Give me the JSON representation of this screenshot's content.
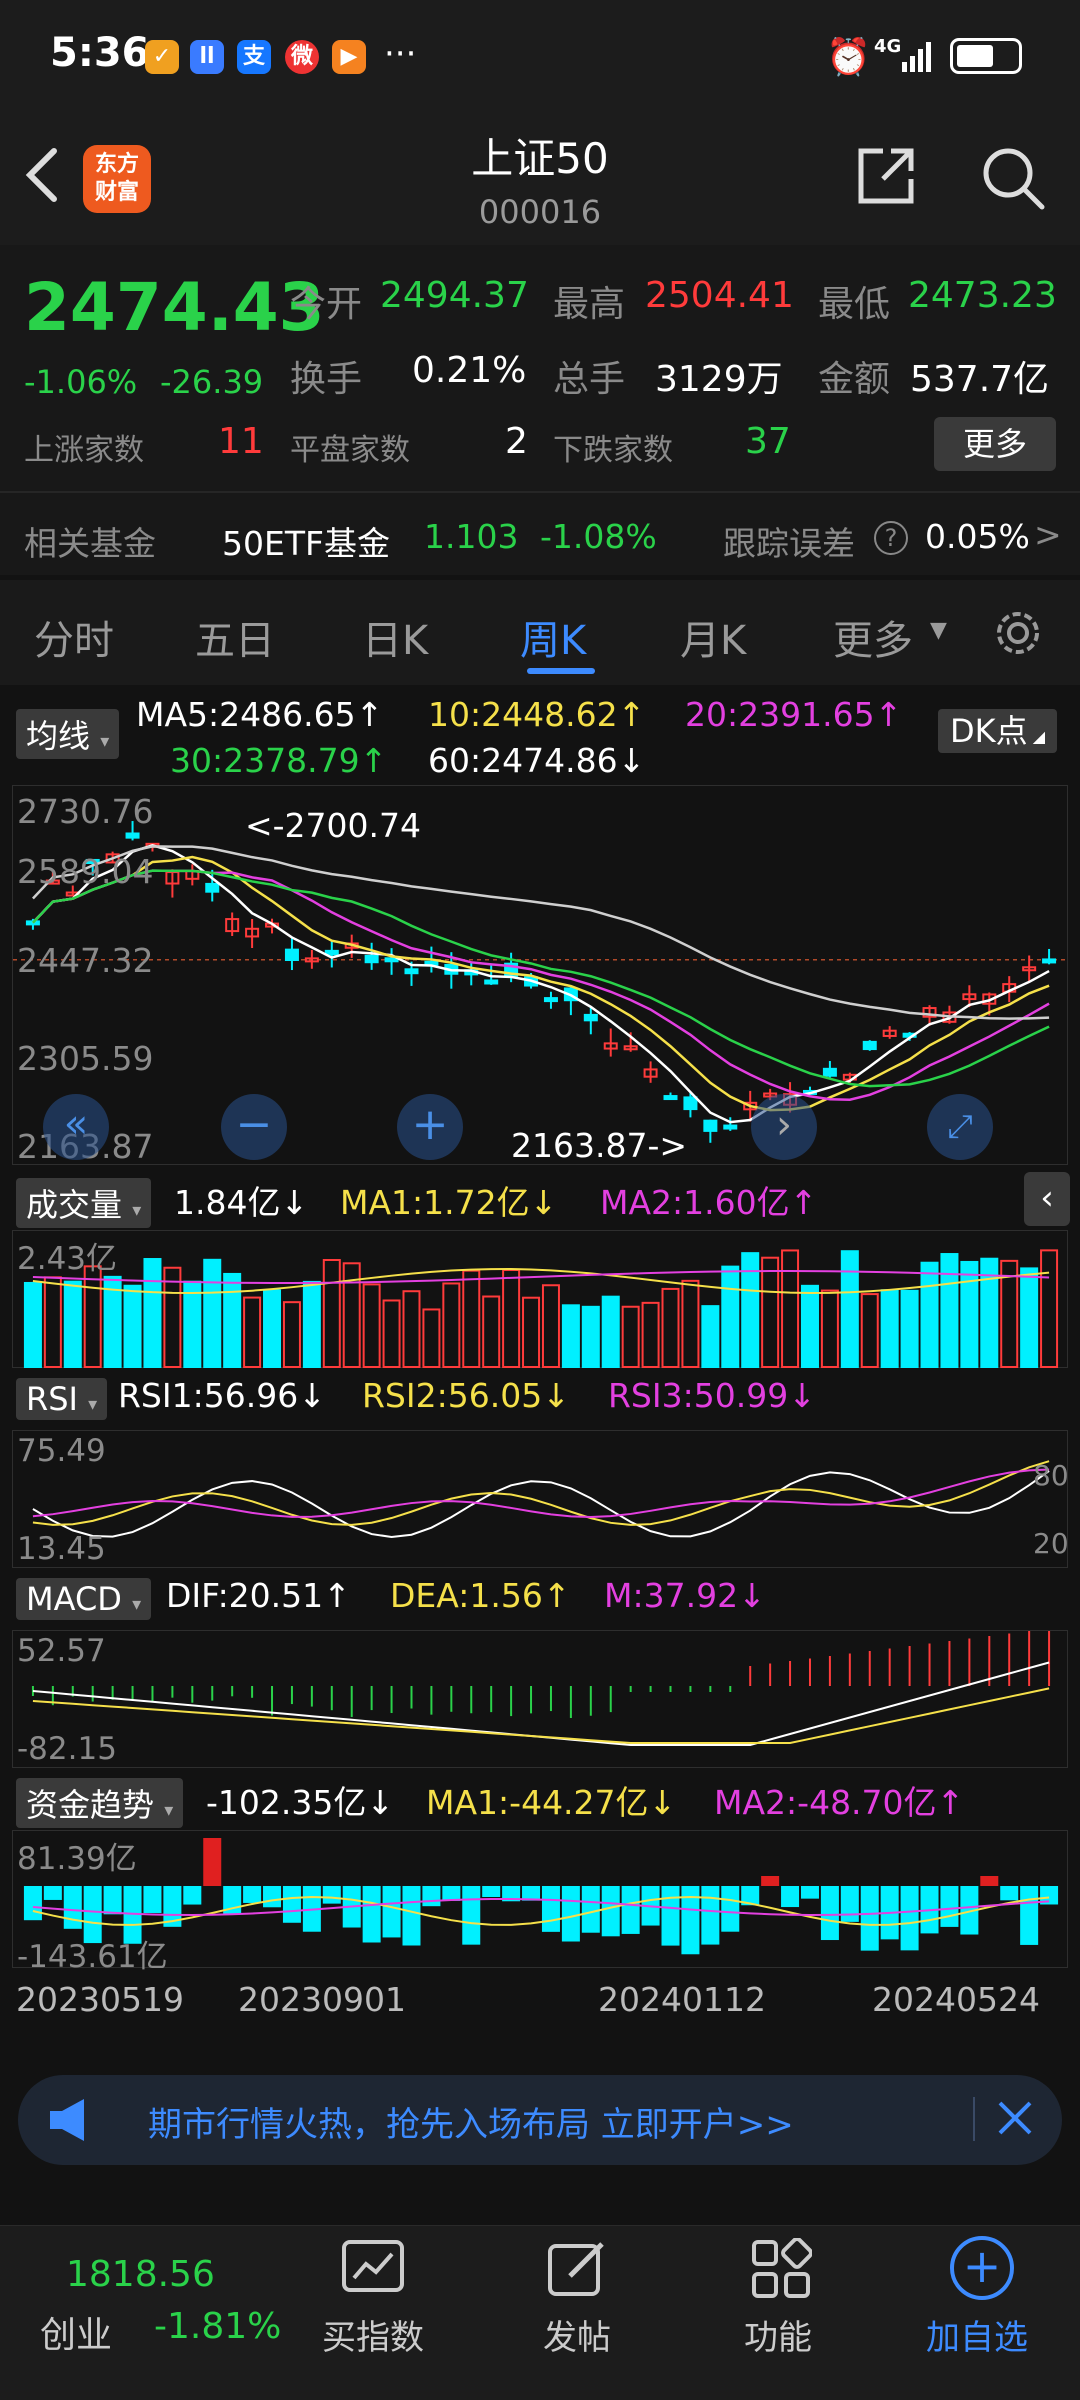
{
  "status_bar": {
    "time": "5:36",
    "more": "···",
    "network": "4G"
  },
  "header": {
    "title": "上证50",
    "code": "000016",
    "logo_text_1": "东方",
    "logo_text_2": "财富"
  },
  "quote": {
    "price": "2474.43",
    "change_pct": "-1.06%",
    "change": "-26.39",
    "open_label": "今开",
    "open": "2494.37",
    "high_label": "最高",
    "high": "2504.41",
    "low_label": "最低",
    "low": "2473.23",
    "turnover_label": "换手",
    "turnover": "0.21%",
    "volume_label": "总手",
    "volume": "3129万",
    "amount_label": "金额",
    "amount": "537.7亿",
    "up_label": "上涨家数",
    "up": "11",
    "flat_label": "平盘家数",
    "flat": "2",
    "down_label": "下跌家数",
    "down": "37",
    "more_btn": "更多"
  },
  "fund": {
    "label": "相关基金",
    "name": "50ETF基金",
    "price": "1.103",
    "pct": "-1.08%",
    "tracking_label": "跟踪误差",
    "tracking": "0.05%",
    "arrow": ">"
  },
  "tabs": [
    "分时",
    "五日",
    "日K",
    "周K",
    "月K",
    "更多"
  ],
  "active_tab": "周K",
  "ma": {
    "label": "均线",
    "ma5": "MA5:2486.65↑",
    "ma10": "10:2448.62↑",
    "ma20": "20:2391.65↑",
    "ma30": "30:2378.79↑",
    "ma60": "60:2474.86↓",
    "dk": "DK点"
  },
  "kline": {
    "axis": [
      "2730.76",
      "2589.04",
      "2447.32",
      "2305.59",
      "2163.87"
    ],
    "high_marker": "<-2700.74",
    "low_marker": "2163.87->"
  },
  "volume": {
    "label": "成交量",
    "value": "1.84亿↓",
    "ma1": "MA1:1.72亿↓",
    "ma2": "MA2:1.60亿↑",
    "axis": "2.43亿"
  },
  "rsi": {
    "label": "RSI",
    "rsi1": "RSI1:56.96↓",
    "rsi2": "RSI2:56.05↓",
    "rsi3": "RSI3:50.99↓",
    "top": "75.49",
    "bottom": "13.45",
    "r80": "80",
    "r20": "20"
  },
  "macd": {
    "label": "MACD",
    "dif": "DIF:20.51↑",
    "dea": "DEA:1.56↑",
    "m": "M:37.92↓",
    "top": "52.57",
    "bottom": "-82.15"
  },
  "funds_trend": {
    "label": "资金趋势",
    "value": "-102.35亿↓",
    "ma1": "MA1:-44.27亿↓",
    "ma2": "MA2:-48.70亿↑",
    "top": "81.39亿",
    "bottom": "-143.61亿"
  },
  "dates": [
    "20230519",
    "20230901",
    "20240112",
    "20240524"
  ],
  "banner": {
    "text": "期市行情火热，抢先入场布局 立即开户>>"
  },
  "bottom_nav": {
    "index_value": "1818.56",
    "index_name": "创业",
    "index_pct": "-1.81%",
    "items": [
      "买指数",
      "发帖",
      "功能",
      "加自选"
    ]
  },
  "colors": {
    "up": "#ff3b3b",
    "down": "#00f0ff",
    "green_text": "#2ad24a",
    "accent": "#3d8bff"
  }
}
